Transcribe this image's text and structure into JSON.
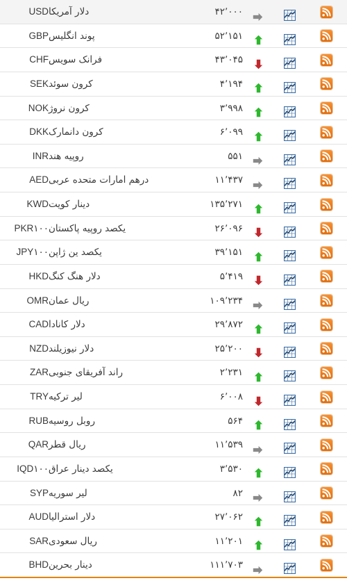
{
  "table": {
    "name": "currency-exchange-rates",
    "colors": {
      "rss_orange": "#ec7b1b",
      "chart_blue": "#3c6ea5",
      "up_green": "#2eb82e",
      "down_red": "#c0282d",
      "flat_gray": "#8a8a8a",
      "row_alt_bg": "#f4f4f4",
      "row_bg": "#ffffff",
      "border": "#e2e2e2",
      "footer_border": "#e8820c",
      "text": "#3a3a3a"
    },
    "icons": {
      "rss": "rss-icon",
      "chart": "chart-icon",
      "up": "arrow-up-icon",
      "down": "arrow-down-icon",
      "flat": "arrow-right-icon"
    },
    "rows": [
      {
        "symbol": "USD",
        "name": "دلار آمریکا",
        "price": "۴۲٬۰۰۰",
        "trend": "flat"
      },
      {
        "symbol": "GBP",
        "name": "پوند انگلیس",
        "price": "۵۲٬۱۵۱",
        "trend": "up"
      },
      {
        "symbol": "CHF",
        "name": "فرانک سویس",
        "price": "۴۳٬۰۴۵",
        "trend": "down"
      },
      {
        "symbol": "SEK",
        "name": "کرون سوئد",
        "price": "۴٬۱۹۴",
        "trend": "up"
      },
      {
        "symbol": "NOK",
        "name": "کرون نروژ",
        "price": "۳٬۹۹۸",
        "trend": "up"
      },
      {
        "symbol": "DKK",
        "name": "کرون دانمارک",
        "price": "۶٬۰۹۹",
        "trend": "up"
      },
      {
        "symbol": "INR",
        "name": "روپیه هند",
        "price": "۵۵۱",
        "trend": "flat"
      },
      {
        "symbol": "AED",
        "name": "درهم امارات متحده عربی",
        "price": "۱۱٬۴۳۷",
        "trend": "flat"
      },
      {
        "symbol": "KWD",
        "name": "دینار کویت",
        "price": "۱۳۵٬۲۷۱",
        "trend": "up"
      },
      {
        "symbol": "PKR۱۰۰",
        "name": "یکصد روپیه پاکستان",
        "price": "۲۶٬۰۹۶",
        "trend": "down"
      },
      {
        "symbol": "JPY۱۰۰",
        "name": "یکصد ین ژاپن",
        "price": "۳۹٬۱۵۱",
        "trend": "up"
      },
      {
        "symbol": "HKD",
        "name": "دلار هنگ کنگ",
        "price": "۵٬۴۱۹",
        "trend": "down"
      },
      {
        "symbol": "OMR",
        "name": "ریال عمان",
        "price": "۱۰۹٬۲۳۴",
        "trend": "flat"
      },
      {
        "symbol": "CAD",
        "name": "دلار کانادا",
        "price": "۲۹٬۸۷۲",
        "trend": "up"
      },
      {
        "symbol": "NZD",
        "name": "دلار نیوزیلند",
        "price": "۲۵٬۲۰۰",
        "trend": "down"
      },
      {
        "symbol": "ZAR",
        "name": "راند آفریقای جنوبی",
        "price": "۲٬۲۳۱",
        "trend": "up"
      },
      {
        "symbol": "TRY",
        "name": "لیر ترکیه",
        "price": "۶٬۰۰۸",
        "trend": "down"
      },
      {
        "symbol": "RUB",
        "name": "روبل روسیه",
        "price": "۵۶۴",
        "trend": "up"
      },
      {
        "symbol": "QAR",
        "name": "ریال قطر",
        "price": "۱۱٬۵۳۹",
        "trend": "flat"
      },
      {
        "symbol": "IQD۱۰۰",
        "name": "یکصد دینار عراق",
        "price": "۳٬۵۳۰",
        "trend": "up"
      },
      {
        "symbol": "SYP",
        "name": "لیر سوریه",
        "price": "۸۲",
        "trend": "flat"
      },
      {
        "symbol": "AUD",
        "name": "دلار استرالیا",
        "price": "۲۷٬۰۶۲",
        "trend": "up"
      },
      {
        "symbol": "SAR",
        "name": "ریال سعودی",
        "price": "۱۱٬۲۰۱",
        "trend": "up"
      },
      {
        "symbol": "BHD",
        "name": "دینار بحرین",
        "price": "۱۱۱٬۷۰۳",
        "trend": "flat"
      }
    ]
  }
}
